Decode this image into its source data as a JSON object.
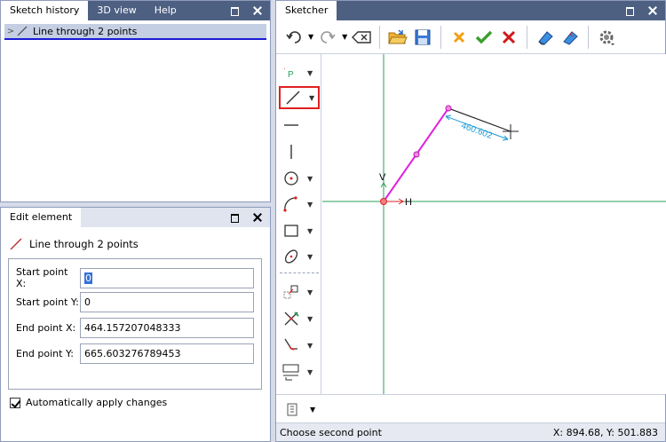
{
  "history": {
    "tabs": [
      "Sketch history",
      "3D view",
      "Help"
    ],
    "item_label": "Line through 2 points"
  },
  "edit": {
    "tab": "Edit element",
    "title": "Line through 2 points",
    "fields": [
      {
        "label": "Start point X:",
        "value": "0"
      },
      {
        "label": "Start point Y:",
        "value": "0"
      },
      {
        "label": "End point X:",
        "value": "464.157207048333"
      },
      {
        "label": "End point Y:",
        "value": "665.603276789453"
      }
    ],
    "auto_apply_label": "Automatically apply changes"
  },
  "sketcher": {
    "tab": "Sketcher",
    "dimension_label": "460.602",
    "h_label": "H",
    "v_label": "V",
    "status_text": "Choose second point",
    "coords": "X: 894.68, Y: 501.883",
    "colors": {
      "line": "#e020e0",
      "axis": "#2aa05a",
      "dim": "#1a9ad6",
      "selected_border": "#e02020"
    }
  }
}
